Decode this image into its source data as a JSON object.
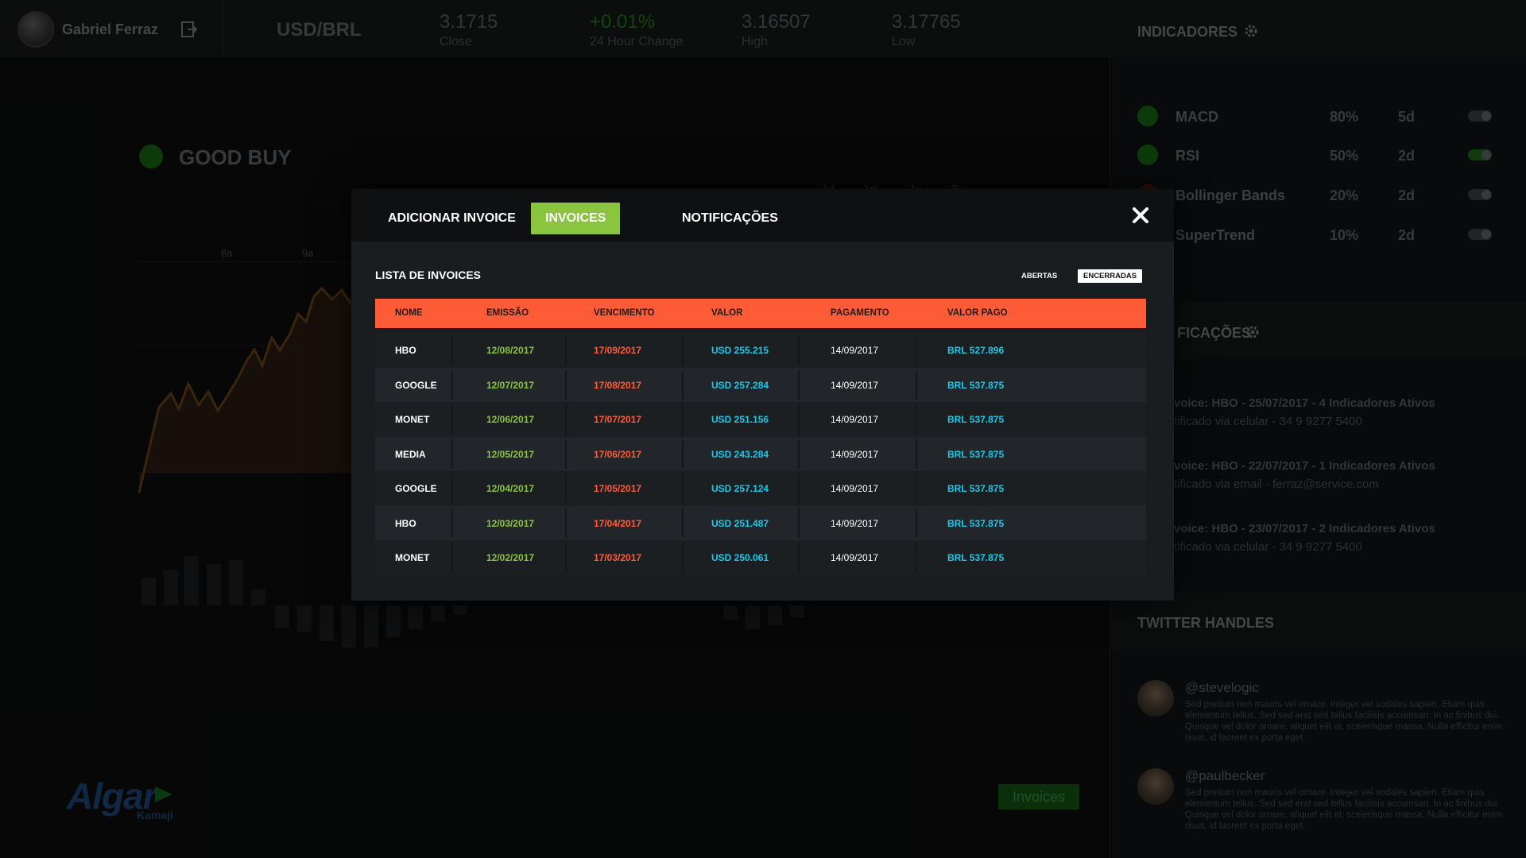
{
  "header": {
    "user_name": "Gabriel Ferraz",
    "pair": "USD/BRL",
    "stats": [
      {
        "value": "3.1715",
        "label": "Close"
      },
      {
        "value": "+0.01%",
        "label": "24 Hour Change"
      },
      {
        "value": "3.16507",
        "label": "High"
      },
      {
        "value": "3.17765",
        "label": "Low"
      }
    ]
  },
  "indicators": {
    "title": "INDICADORES",
    "items": [
      {
        "name": "MACD",
        "pct": "80%",
        "days": "5d",
        "on": false
      },
      {
        "name": "RSI",
        "pct": "50%",
        "days": "2d",
        "on": true
      },
      {
        "name": "Bollinger Bands",
        "pct": "20%",
        "days": "2d",
        "on": false
      },
      {
        "name": "SuperTrend",
        "pct": "10%",
        "days": "2d",
        "on": false
      }
    ]
  },
  "notifications": {
    "title": "FICAÇÕES",
    "items": [
      {
        "title": "voice: HBO - 25/07/2017 - 4 Indicadores Ativos",
        "sub": "tificado via celular - 34 9 9277 5400"
      },
      {
        "title": "voice: HBO - 22/07/2017 - 1 Indicadores Ativos",
        "sub": "tificado via email - ferraz@service.com"
      },
      {
        "title": "voice: HBO - 23/07/2017 - 2 Indicadores Ativos",
        "sub": "tificado via celular - 34 9 9277 5400"
      }
    ]
  },
  "twitter": {
    "title": "TWITTER HANDLES",
    "items": [
      {
        "handle": "@stevelogic",
        "text": "Sed pretium non mauris vel ornare. Integer vel sodales sapien. Etiam quis elementum tellus. Sed sed erat sed tellus facilisis accumsan. In ac finibus dui. Quisque vel dolor ornare, aliquet elit at, scelerisque massa. Nulla efficitur enim risus, id laoreet ex porta eget."
      },
      {
        "handle": "@paulbecker",
        "text": "Sed pretium non mauris vel ornare. Integer vel sodales sapien. Etiam quis elementum tellus. Sed sed erat sed tellus facilisis accumsan. In ac finibus dui. Quisque vel dolor ornare, aliquet elit at, scelerisque massa. Nulla efficitur enim risus, id laoreet ex porta eget."
      }
    ]
  },
  "signal": {
    "label": "GOOD BUY"
  },
  "ranges": [
    "1d",
    "1m",
    "1y",
    "5y"
  ],
  "time_labels": [
    "8a",
    "9a"
  ],
  "brand": {
    "name": "Algar",
    "sub": "Kamaji"
  },
  "invoices_button": "Invoices",
  "modal": {
    "tabs": [
      "ADICIONAR INVOICE",
      "INVOICES",
      "NOTIFICAÇÕES"
    ],
    "active_tab": 1,
    "close_icon": "close-icon",
    "list_title": "LISTA DE INVOICES",
    "filters": {
      "open": "ABERTAS",
      "closed": "ENCERRADAS"
    },
    "columns": [
      "NOME",
      "EMISSÃO",
      "VENCIMENTO",
      "VALOR",
      "PAGAMENTO",
      "VALOR PAGO"
    ],
    "rows": [
      [
        "HBO",
        "12/08/2017",
        "17/09/2017",
        "USD 255.215",
        "14/09/2017",
        "BRL 527.896"
      ],
      [
        "GOOGLE",
        "12/07/2017",
        "17/08/2017",
        "USD 257.284",
        "14/09/2017",
        "BRL 537.875"
      ],
      [
        "MONET",
        "12/06/2017",
        "17/07/2017",
        "USD 251.156",
        "14/09/2017",
        "BRL 537.875"
      ],
      [
        "MEDIA",
        "12/05/2017",
        "17/06/2017",
        "USD 243.284",
        "14/09/2017",
        "BRL 537.875"
      ],
      [
        "GOOGLE",
        "12/04/2017",
        "17/05/2017",
        "USD 257.124",
        "14/09/2017",
        "BRL 537.875"
      ],
      [
        "HBO",
        "12/03/2017",
        "17/04/2017",
        "USD 251.487",
        "14/09/2017",
        "BRL 537.875"
      ],
      [
        "MONET",
        "12/02/2017",
        "17/03/2017",
        "USD 250.061",
        "14/09/2017",
        "BRL 537.875"
      ]
    ]
  },
  "colors": {
    "accent_green": "#8bc53f",
    "header_orange": "#ff5b36",
    "value_cyan": "#18c9ea"
  }
}
